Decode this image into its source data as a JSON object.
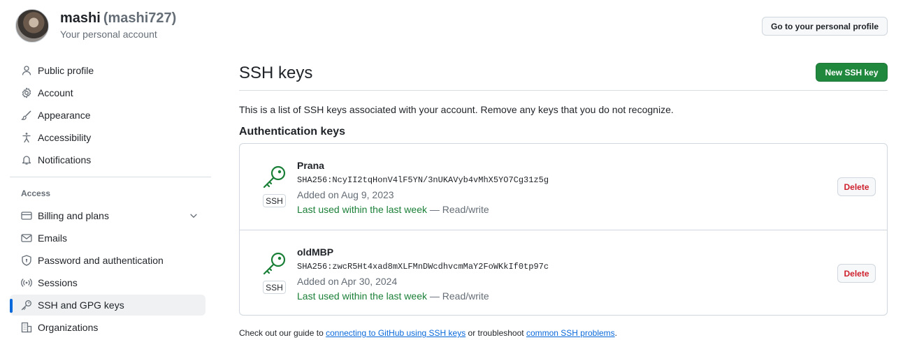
{
  "header": {
    "name": "mashi",
    "handle": "(mashi727)",
    "subtitle": "Your personal account",
    "profile_button": "Go to your personal profile"
  },
  "sidebar": {
    "items": [
      {
        "label": "Public profile",
        "icon": "person-icon"
      },
      {
        "label": "Account",
        "icon": "gear-icon"
      },
      {
        "label": "Appearance",
        "icon": "paintbrush-icon"
      },
      {
        "label": "Accessibility",
        "icon": "accessibility-icon"
      },
      {
        "label": "Notifications",
        "icon": "bell-icon"
      }
    ],
    "access_label": "Access",
    "access_items": [
      {
        "label": "Billing and plans",
        "icon": "credit-card-icon"
      },
      {
        "label": "Emails",
        "icon": "mail-icon"
      },
      {
        "label": "Password and authentication",
        "icon": "shield-lock-icon"
      },
      {
        "label": "Sessions",
        "icon": "broadcast-icon"
      },
      {
        "label": "SSH and GPG keys",
        "icon": "key-icon"
      },
      {
        "label": "Organizations",
        "icon": "organization-icon"
      }
    ]
  },
  "main": {
    "title": "SSH keys",
    "new_button": "New SSH key",
    "intro": "This is a list of SSH keys associated with your account. Remove any keys that you do not recognize.",
    "section_title": "Authentication keys",
    "keys": [
      {
        "title": "Prana",
        "fingerprint": "SHA256:NcyII2tqHonV4lF5YN/3nUKAVyb4vMhX5YO7Cg31z5g",
        "added": "Added on Aug 9, 2023",
        "used": "Last used within the last week",
        "access": "— Read/write",
        "badge": "SSH",
        "delete": "Delete"
      },
      {
        "title": "oldMBP",
        "fingerprint": "SHA256:zwcR5Ht4xad8mXLFMnDWcdhvcmMaY2FoWKkIf0tp97c",
        "added": "Added on Apr 30, 2024",
        "used": "Last used within the last week",
        "access": "— Read/write",
        "badge": "SSH",
        "delete": "Delete"
      }
    ],
    "footer": {
      "prefix": "Check out our guide to",
      "link1": "connecting to GitHub using SSH keys",
      "middle": "or troubleshoot",
      "link2": "common SSH problems",
      "suffix": "."
    }
  },
  "colors": {
    "accent": "#0969da",
    "primary_button": "#1f883d",
    "success_text": "#1a7f37",
    "danger_text": "#cf222e"
  }
}
